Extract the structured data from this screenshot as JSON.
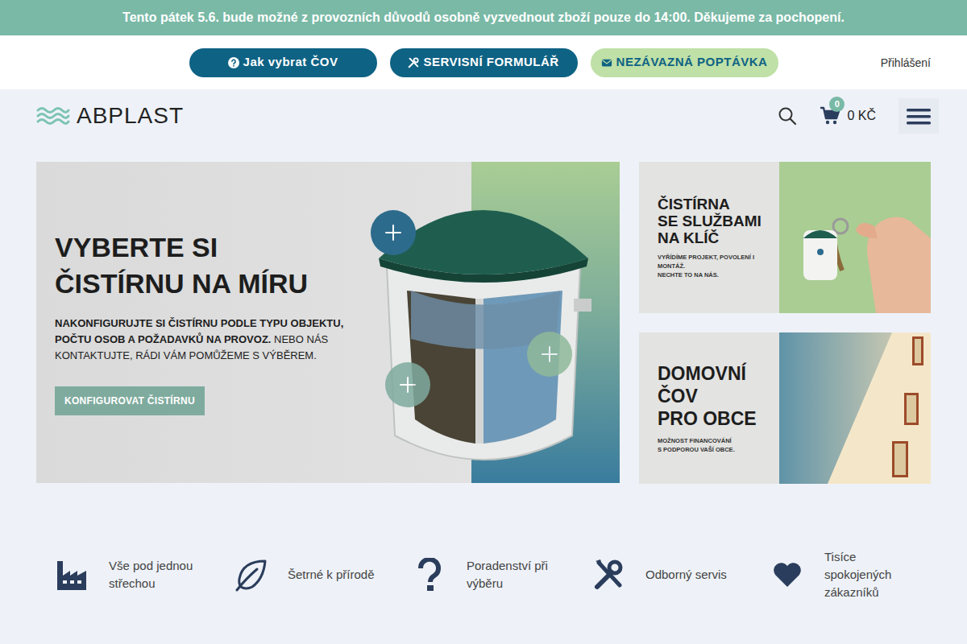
{
  "announcement": "Tento pátek 5.6. bude možné z provozních důvodů osobně vyzvednout zboží pouze do 14:00. Děkujeme za pochopení.",
  "top_buttons": [
    {
      "label": "Jak vybrat ČOV",
      "kind": "dark"
    },
    {
      "label": "SERVISNÍ FORMULÁŘ",
      "kind": "dark"
    },
    {
      "label": "NEZÁVAZNÁ POPTÁVKA",
      "kind": "light"
    }
  ],
  "login": "Přihlášení",
  "logo": "ABPLAST",
  "cart": {
    "count": "0",
    "total": "0 KČ"
  },
  "hero": {
    "title_lines": [
      "VYBERTE SI",
      "ČISTÍRNU NA MÍRU"
    ],
    "lead_bold": "NAKONFIGURUJTE SI ČISTÍRNU PODLE TYPU OBJEKTU, POČTU OSOB A POŽADAVKŮ NA PROVOZ.",
    "lead": "NEBO NÁS KONTAKTUJTE, RÁDI VÁM POMŮŽEME S VÝBĚREM.",
    "button": "KONFIGUROVAT ČISTÍRNU"
  },
  "promos": [
    {
      "title_lines": [
        "ČISTÍRNA",
        "SE SLUŽBAMI",
        "NA KLÍČ"
      ],
      "text_lines": [
        "VYŘÍDÍME PROJEKT, POVOLENÍ I MONTÁŽ.",
        "NECHTE TO NA NÁS."
      ]
    },
    {
      "title_lines": [
        "DOMOVNÍ",
        "ČOV",
        "PRO OBCE"
      ],
      "text_lines": [
        "MOŽNOST FINANCOVÁNÍ",
        "S PODPOROU VAŠÍ OBCE."
      ]
    }
  ],
  "features": [
    "Vše pod jednou střechou",
    "Šetrné k přírodě",
    "Poradenství při výběru",
    "Odborný servis",
    "Tisíce spokojených zákazníků"
  ]
}
